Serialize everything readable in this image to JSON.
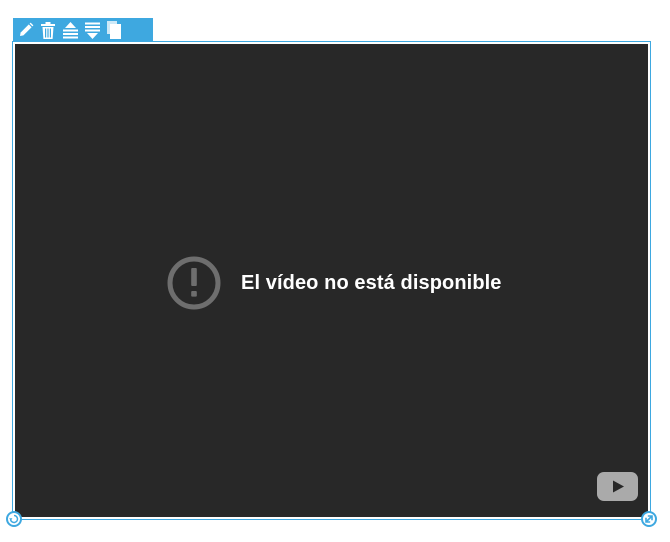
{
  "toolbar": {
    "icons": [
      "pencil-icon",
      "trash-icon",
      "bring-forward-icon",
      "send-backward-icon",
      "copy-icon"
    ]
  },
  "player": {
    "error_message": "El vídeo no está disponible",
    "error_icon": "exclamation-circle-icon",
    "logo": "youtube-icon"
  },
  "handles": {
    "left": "rotate-icon",
    "right": "resize-icon"
  },
  "colors": {
    "accent": "#3ea8e0",
    "player_bg": "#282828",
    "error_icon": "#6e6e6e",
    "text": "#ffffff",
    "logo": "#aaaaaa"
  }
}
